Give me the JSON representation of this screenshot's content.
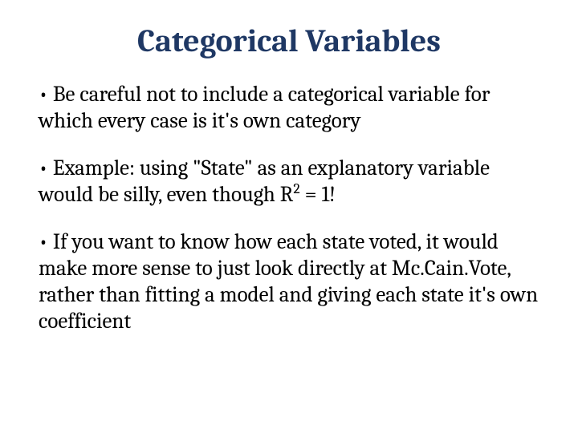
{
  "title": "Categorical Variables",
  "bullets": {
    "b1": "• Be careful not to include a categorical variable for which every case is it's own category",
    "b2_pre": "• Example: using \"State\" as an explanatory variable would be silly, even though R",
    "b2_sup": "2",
    "b2_post": " = 1!",
    "b3": "• If you want to know how each state voted, it would make more sense to just look directly at Mc.Cain.Vote, rather than fitting a model and giving each state it's own coefficient"
  }
}
